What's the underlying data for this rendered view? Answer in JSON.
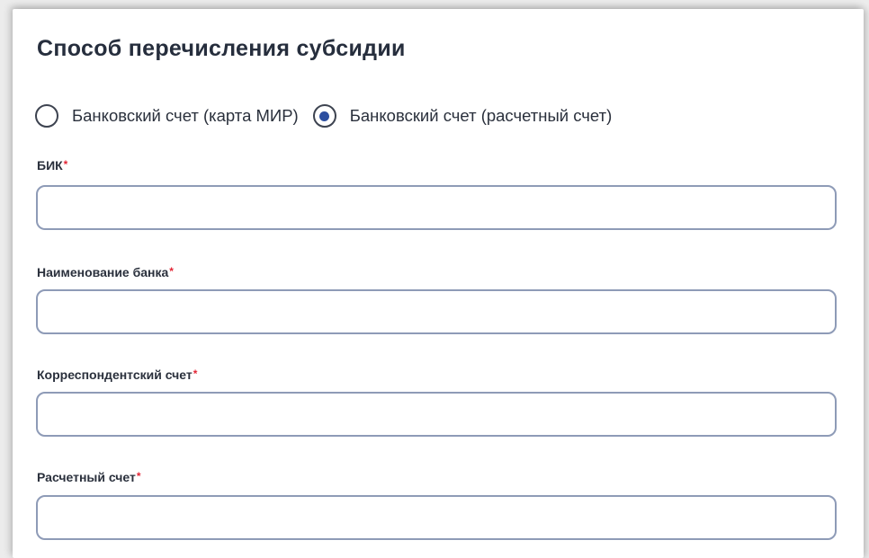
{
  "section": {
    "title": "Способ перечисления субсидии"
  },
  "payment_method": {
    "options": [
      {
        "label": "Банковский счет (карта МИР)",
        "selected": false
      },
      {
        "label": "Банковский счет (расчетный счет)",
        "selected": true
      }
    ]
  },
  "fields": {
    "bik": {
      "label": "БИК",
      "required_mark": "*",
      "value": ""
    },
    "bank_name": {
      "label": "Наименование банка",
      "required_mark": "*",
      "value": ""
    },
    "corr_account": {
      "label": "Корреспондентский счет",
      "required_mark": "*",
      "value": ""
    },
    "settlement_account": {
      "label": "Расчетный счет",
      "required_mark": "*",
      "value": ""
    }
  },
  "colors": {
    "accent": "#2d4fa0",
    "required": "#e32636",
    "input_border": "#8e9bb7",
    "text": "#2a303c"
  }
}
